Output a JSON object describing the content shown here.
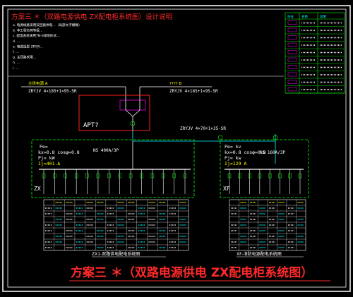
{
  "header": {
    "title": "方案三 ＊（双路电源供电 ZX配电柜系统图）设计说明",
    "notes": [
      "a. 电源线路采用双回路供电…（局部文字模糊）",
      "b. 本工程负荷等级…",
      "c. 配电系统采用TN-S接地形式…",
      "d. …",
      "e. 电缆选型 ZRYJV…",
      "f. …",
      "g. 主回路采用…",
      "h. …",
      "i. …"
    ]
  },
  "legend": {
    "header_cols": [
      "符号",
      "名称",
      "说明"
    ],
    "rows": 10
  },
  "feeders": {
    "left_label": "主供电源 A",
    "left_cable": "ZRYJV 4×185+1×95-SR",
    "right_label": "???? B",
    "right_cable": "ZRYJV 4×185+1×95-SR",
    "apt": "APT?",
    "link_cable": "ZRYJV 4×70+1×35-SR"
  },
  "zx_panel": {
    "pe": "Pe=",
    "kx": "kx=0.8  cosφ=0.8",
    "pj": "Pj=  kW",
    "ij": "Ij=401.A",
    "breaker": "NS 400A/3P",
    "tag": "ZX",
    "caption": "ZX1-双路供电配电系统图"
  },
  "xf_panel": {
    "pe": "Pe=  kv",
    "kx": "kx=0.8  cosφ=0.8",
    "pj": "Pj=  kw",
    "ij": "Ij=129  A",
    "breaker": "NS 160A/3P",
    "tag": "XF",
    "caption": "XF-消防电源配电系统图"
  },
  "main_title": "方案三 ＊（双路电源供电 ZX配电柜系统图）",
  "colors": {
    "bg": "#000000",
    "frame": "#ffffff",
    "green": "#00ff00",
    "cyan": "#00ffff",
    "yellow": "#ffff00",
    "red": "#ff2020",
    "magenta": "#ff00ff",
    "title_red": "#ff2a2a"
  }
}
